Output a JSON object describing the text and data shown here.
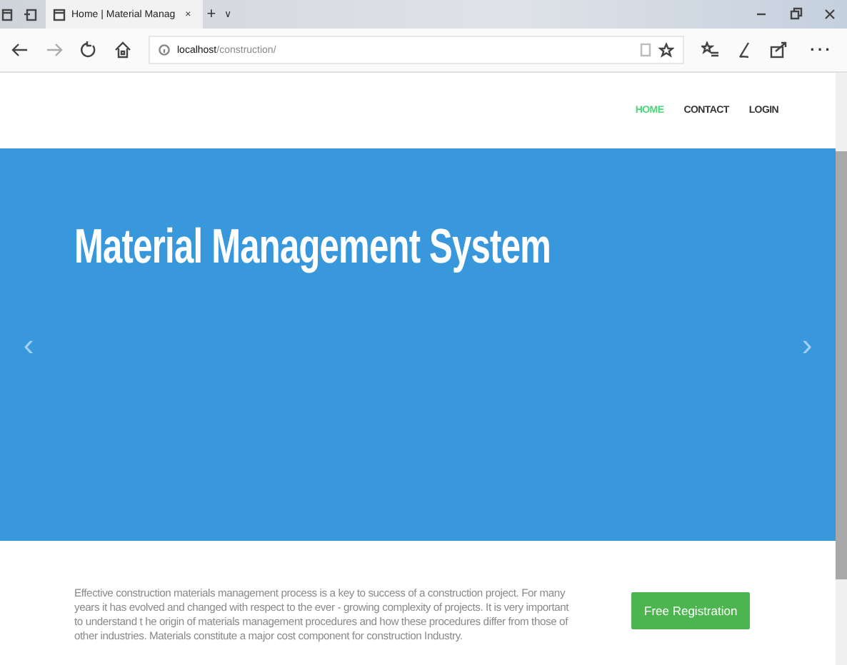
{
  "browser": {
    "tab_title": "Home | Material Manag",
    "tab_close": "×",
    "new_tab": "+",
    "tab_menu": "∨",
    "url_host": "localhost",
    "url_path": "/construction/",
    "more": "···"
  },
  "nav": [
    {
      "label": "HOME",
      "selected": true
    },
    {
      "label": "CONTACT",
      "selected": false
    },
    {
      "label": "LOGIN",
      "selected": false
    }
  ],
  "hero": {
    "title": "Material Management System",
    "prev": "‹",
    "next": "›"
  },
  "intro": {
    "text": "Effective construction materials management process is a key to success of a construction project. For many years it has evolved and changed with respect to the ever - growing complexity of projects. It is very important to understand t he origin of materials management procedures and how these procedures differ from those of other industries. Materials constitute a major cost component for construction Industry.",
    "button": "Free Registration"
  }
}
